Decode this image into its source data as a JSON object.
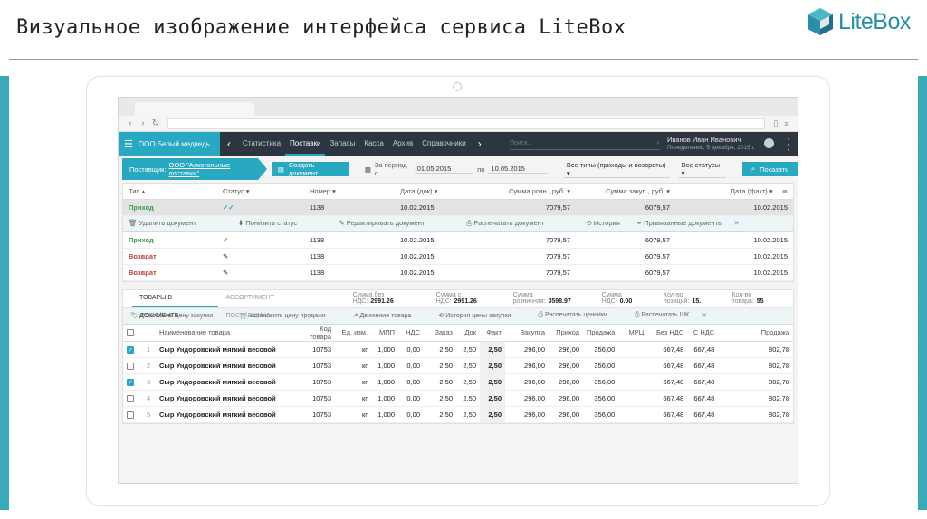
{
  "slide": {
    "title": "Визуальное изображение интерфейса сервиса LiteBox",
    "logo_text": "LiteBox",
    "accent": "#29a9c1"
  },
  "appbar": {
    "org": "ООО Белый медведь",
    "tabs": [
      "Статистика",
      "Поставки",
      "Запасы",
      "Касса",
      "Архив",
      "Справочники"
    ],
    "active_tab": "Поставки",
    "search_placeholder": "Поиск...",
    "user_name": "Иванов Иван Иванович",
    "user_date": "Понедельник, 5 декабря, 2015 г."
  },
  "filters": {
    "supplier_label": "Поставщик:",
    "supplier_value": "ООО \"Алкогольные поставки\"",
    "create_button": "Создать документ",
    "period_label": "За период с",
    "date_from": "01.05.2015",
    "to_label": "по",
    "date_to": "10.05.2015",
    "type_select": "Все типы (приходы и возвраты)",
    "status_select": "Все статусы",
    "show_button": "Показать"
  },
  "docs": {
    "headers": [
      "Тип",
      "Статус",
      "Номер",
      "Дата (док)",
      "Сумма розн., руб.",
      "Сумма закуп., руб.",
      "Дата (факт)"
    ],
    "rows": [
      {
        "type": "Приход",
        "number": "1138",
        "date": "10.02.2015",
        "retail": "7079,57",
        "purchase": "6079,57",
        "fact": "10.02.2015"
      },
      {
        "type": "Приход",
        "number": "1138",
        "date": "10.02.2015",
        "retail": "7079,57",
        "purchase": "6079,57",
        "fact": "10.02.2015"
      },
      {
        "type": "Возврат",
        "number": "1138",
        "date": "10.02.2015",
        "retail": "7079,57",
        "purchase": "6079,57",
        "fact": "10.02.2015"
      },
      {
        "type": "Возврат",
        "number": "1138",
        "date": "10.02.2015",
        "retail": "7079,57",
        "purchase": "6079,57",
        "fact": "10.02.2015"
      }
    ],
    "actions": [
      "Удалить документ",
      "Понизить статус",
      "Редактировать документ",
      "Распечатать документ",
      "История",
      "Привязанные документы"
    ]
  },
  "goods": {
    "tabs": [
      "ТОВАРЫ В ДОКУМЕНТЕ",
      "АССОРТИМЕНТ ПОСТАВЩИКА"
    ],
    "sum_no_vat_label": "Сумма без НДС:",
    "sum_no_vat": "2991.26",
    "sum_vat_label": "Сумма с НДС:",
    "sum_vat": "2991.26",
    "sum_retail_label": "Сумма розничная:",
    "sum_retail": "3598.97",
    "vat_label": "Сумма НДС:",
    "vat": "0.00",
    "positions_label": "Кол-во позиций:",
    "positions": "15.",
    "qty_label": "Кол-во товара:",
    "qty": "55",
    "toolbar": [
      "Установить цену закупки",
      "Установить цену продажи",
      "Движение товара",
      "История цены закупки",
      "Распечатать ценники",
      "Распечатать ШК"
    ],
    "headers": [
      "Наименование товара",
      "Код товара",
      "Ед. изм.",
      "МПП",
      "НДС",
      "Заказ",
      "Док",
      "Факт",
      "Закупка",
      "Приход",
      "Продажа",
      "МРЦ",
      "Без НДС",
      "С НДС",
      "Продажа"
    ],
    "rows": [
      {
        "checked": true,
        "idx": "1",
        "name": "Сыр Ундоровский мягкий весовой",
        "code": "10753",
        "unit": "кг",
        "mpp": "1,000",
        "nds": "0,00",
        "order": "2,50",
        "doc": "2,50",
        "fact": "2,50",
        "buy": "296,00",
        "income": "296,00",
        "sale": "356,00",
        "mrc": "",
        "novat": "667,48",
        "vat": "667,48",
        "sale2": "802,78"
      },
      {
        "checked": false,
        "idx": "2",
        "name": "Сыр Ундоровский мягкий весовой",
        "code": "10753",
        "unit": "кг",
        "mpp": "1,000",
        "nds": "0,00",
        "order": "2,50",
        "doc": "2,50",
        "fact": "2,50",
        "buy": "296,00",
        "income": "296,00",
        "sale": "356,00",
        "mrc": "",
        "novat": "667,48",
        "vat": "667,48",
        "sale2": "802,78"
      },
      {
        "checked": true,
        "idx": "3",
        "name": "Сыр Ундоровский мягкий весовой",
        "code": "10753",
        "unit": "кг",
        "mpp": "1,000",
        "nds": "0,00",
        "order": "2,50",
        "doc": "2,50",
        "fact": "2,50",
        "buy": "296,00",
        "income": "296,00",
        "sale": "356,00",
        "mrc": "",
        "novat": "667,48",
        "vat": "667,48",
        "sale2": "802,78"
      },
      {
        "checked": false,
        "idx": "4",
        "name": "Сыр Ундоровский мягкий весовой",
        "code": "10753",
        "unit": "кг",
        "mpp": "1,000",
        "nds": "0,00",
        "order": "2,50",
        "doc": "2,50",
        "fact": "2,50",
        "buy": "296,00",
        "income": "296,00",
        "sale": "356,00",
        "mrc": "",
        "novat": "667,48",
        "vat": "667,48",
        "sale2": "802,78"
      },
      {
        "checked": false,
        "idx": "5",
        "name": "Сыр Ундоровский мягкий весовой",
        "code": "10753",
        "unit": "кг",
        "mpp": "1,000",
        "nds": "0,00",
        "order": "2,50",
        "doc": "2,50",
        "fact": "2,50",
        "buy": "296,00",
        "income": "296,00",
        "sale": "356,00",
        "mrc": "",
        "novat": "667,48",
        "vat": "667,48",
        "sale2": "802,78"
      }
    ]
  }
}
